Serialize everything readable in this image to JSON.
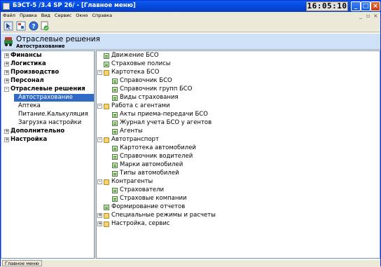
{
  "window": {
    "title": "БЭСТ-5 /3.4 SP 26/ - [Главное меню]",
    "clock": "16:05:10"
  },
  "menubar": {
    "items": [
      "Файл",
      "Правка",
      "Вид",
      "Сервис",
      "Окно",
      "Справка"
    ]
  },
  "header": {
    "title": "Отраслевые решения",
    "subtitle": "Автострахование"
  },
  "left_tree": {
    "finance": "Финансы",
    "logistics": "Логистика",
    "production": "Производство",
    "personnel": "Персонал",
    "industry": "Отраслевые решения",
    "auto_insurance": "Автострахование",
    "pharmacy": "Аптека",
    "food": "Питание.Калькуляция",
    "load_settings": "Загрузка настройки",
    "additional": "Дополнительно",
    "settings": "Настройка"
  },
  "right_tree": {
    "bso_movement": "Движение БСО",
    "insurance_policies": "Страховые полисы",
    "bso_card": "Картотека БСО",
    "bso_directory": "Справочник БСО",
    "bso_group_directory": "Справочник групп БСО",
    "insurance_types": "Виды страхования",
    "agent_work": "Работа с агентами",
    "bso_acts": "Акты приема-передачи БСО",
    "bso_journal": "Журнал учета БСО у агентов",
    "agents": "Агенты",
    "autotransport": "Автотранспорт",
    "car_card": "Картотека автомобилей",
    "driver_directory": "Справочник водителей",
    "car_brands": "Марки автомобилей",
    "car_types": "Типы автомобилей",
    "counterparties": "Контрагенты",
    "insurers": "Страхователи",
    "insurance_companies": "Страховые компании",
    "reports": "Формирование отчетов",
    "special_modes": "Специальные режимы и расчеты",
    "settings_service": "Настройка, сервис"
  },
  "statusbar": {
    "text": "Главное меню"
  },
  "colors": {
    "titlebar": "#0a5cf0",
    "selection": "#316ac5",
    "header_bg": "#cfe1f7"
  }
}
